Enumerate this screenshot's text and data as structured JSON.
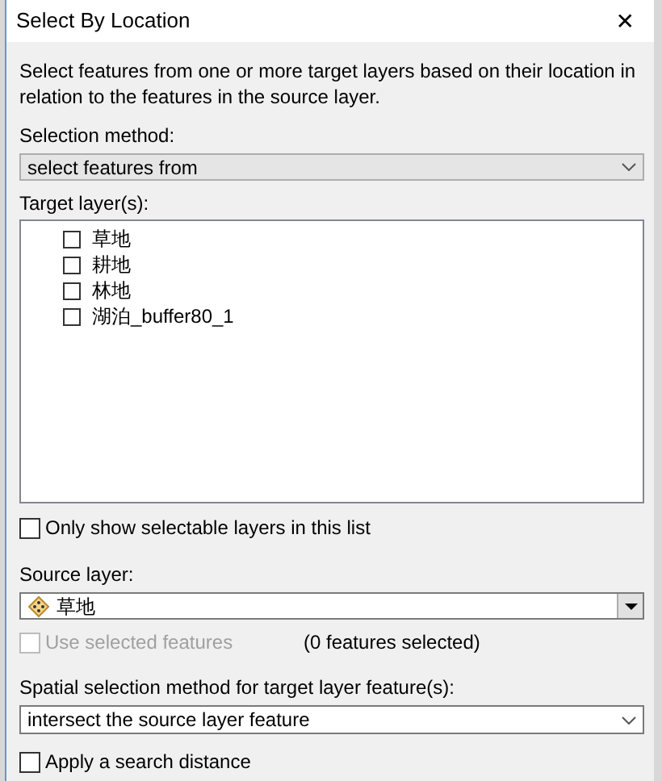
{
  "window": {
    "title": "Select By Location",
    "close": "✕"
  },
  "description": "Select features from one or more target layers based on their location in relation to the features in the source layer.",
  "selection_method": {
    "label": "Selection method:",
    "value": "select features from"
  },
  "target_layers": {
    "label": "Target layer(s):",
    "items": [
      {
        "name": "草地",
        "checked": false
      },
      {
        "name": "耕地",
        "checked": false
      },
      {
        "name": "林地",
        "checked": false
      },
      {
        "name": "湖泊_buffer80_1",
        "checked": false
      }
    ]
  },
  "only_selectable": {
    "label": "Only show selectable layers in this list",
    "checked": false
  },
  "source_layer": {
    "label": "Source layer:",
    "value": "草地"
  },
  "use_selected": {
    "label": "Use selected features",
    "checked": false,
    "disabled": true,
    "count": "(0 features selected)"
  },
  "spatial_method": {
    "label": "Spatial selection method for target layer feature(s):",
    "value": "intersect the source layer feature"
  },
  "search_distance": {
    "label": "Apply a search distance",
    "checked": false
  }
}
